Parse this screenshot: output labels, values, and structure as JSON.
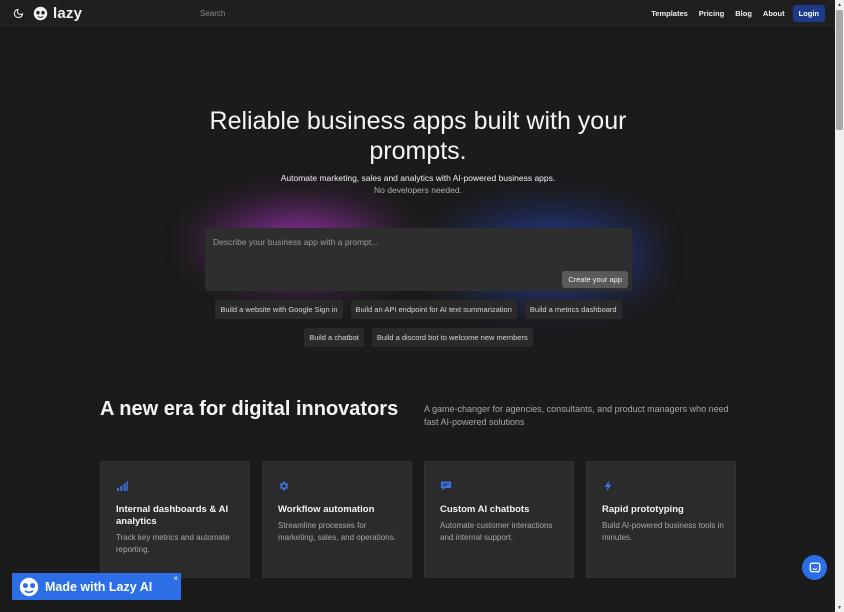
{
  "header": {
    "logo_text": "lazy",
    "search_placeholder": "Search",
    "nav": {
      "templates": "Templates",
      "pricing": "Pricing",
      "blog": "Blog",
      "about": "About",
      "login": "Login"
    }
  },
  "hero": {
    "title": "Reliable business apps built with your prompts.",
    "subtitle": "Automate marketing, sales and analytics with AI-powered business apps.",
    "subtitle2": "No developers needed.",
    "prompt_placeholder": "Describe your business app with a prompt...",
    "create_button": "Create your app",
    "suggestions_row1": [
      "Build a website with Google Sign in",
      "Build an API endpoint for AI text summarization",
      "Build a metrics dashboard"
    ],
    "suggestions_row2": [
      "Build a chatbot",
      "Build a discord bot to welcome new members"
    ]
  },
  "section": {
    "title": "A new era for digital innovators",
    "description": "A game-changer for agencies, consultants, and product managers who need fast AI-powered solutions"
  },
  "cards": [
    {
      "icon": "bar-chart-icon",
      "title": "Internal dashboards & AI analytics",
      "description": "Track key metrics and automate reporting."
    },
    {
      "icon": "gear-icon",
      "title": "Workflow automation",
      "description": "Streamline processes for marketing, sales, and operations."
    },
    {
      "icon": "chat-icon",
      "title": "Custom AI chatbots",
      "description": "Automate customer interactions and internal support."
    },
    {
      "icon": "lightning-icon",
      "title": "Rapid prototyping",
      "description": "Build AI-powered business tools in minutes."
    }
  ],
  "badge": {
    "text": "Made with Lazy AI",
    "close": "×"
  },
  "colors": {
    "background": "#1b1b1b",
    "accent_blue": "#2c6ee6",
    "login_bg": "#1e3a8a",
    "card_bg": "#2b2b2b",
    "glow_purple": "#c437dc",
    "glow_blue": "#2850e6"
  }
}
